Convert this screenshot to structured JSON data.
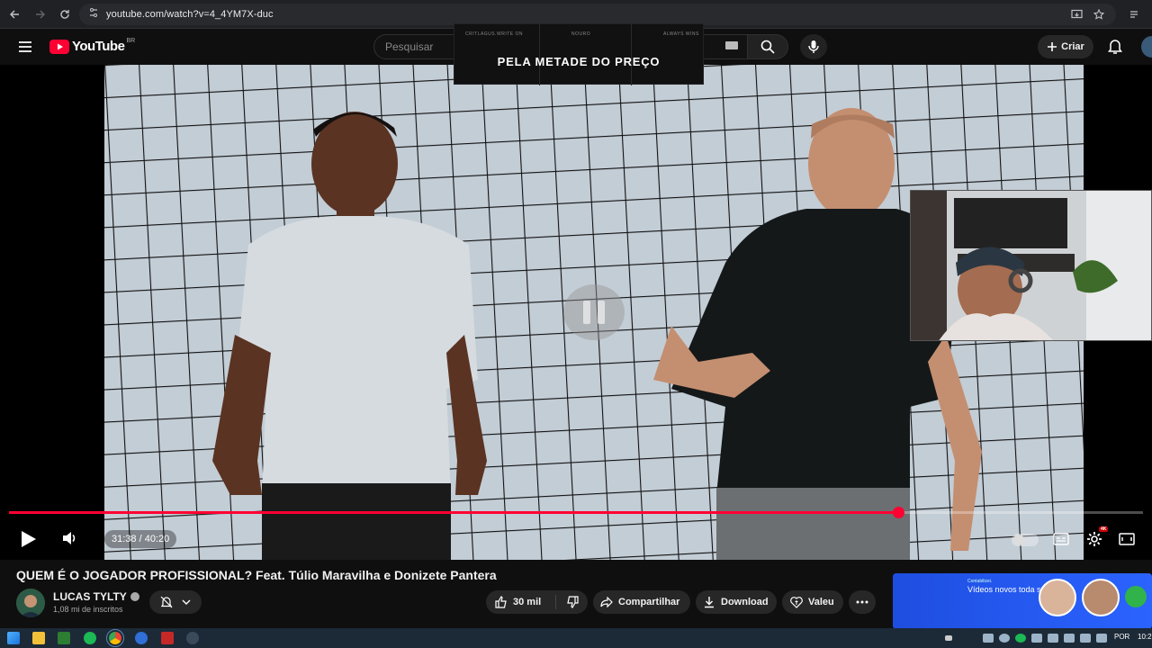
{
  "browser": {
    "url": "youtube.com/watch?v=4_4YM7X-duc",
    "icons": [
      "back-icon",
      "forward-icon",
      "reload-icon",
      "site-settings-icon",
      "install-icon",
      "bookmark-star-icon",
      "tab-search-icon"
    ]
  },
  "header": {
    "logo_text": "YouTube",
    "region": "BR",
    "search_placeholder": "Pesquisar",
    "create_label": "Criar"
  },
  "ad": {
    "headline": "PELA METADE DO PREÇO",
    "mini_labels": [
      "CRITLAGUS.WRITE ON",
      "NOURO",
      "ALWAYS WINS"
    ]
  },
  "player": {
    "current_time": "31:38",
    "duration": "40:20",
    "time_display": "31:38 / 40:20",
    "progress_fraction": 0.784,
    "state": "paused",
    "hd_badge": "4K",
    "accent_color": "#ff0033"
  },
  "video": {
    "title": "QUEM É O JOGADOR PROFISSIONAL? Feat. Túlio Maravilha e Donizete Pantera"
  },
  "channel": {
    "name": "LUCAS TYLTY",
    "subscribers": "1,08 mi de inscritos"
  },
  "actions": {
    "likes": "30 mil",
    "share": "Compartilhar",
    "download": "Download",
    "thanks": "Valeu"
  },
  "promo": {
    "brand": "Contabilizei.",
    "headline": "Vídeos novos toda semana."
  },
  "taskbar": {
    "language": "POR",
    "time": "10:2"
  }
}
